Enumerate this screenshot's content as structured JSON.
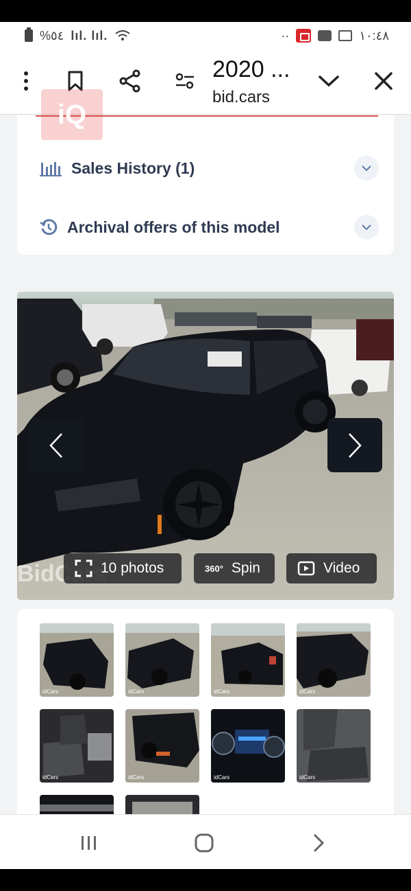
{
  "status_bar": {
    "battery_text": "%٥٤",
    "signal_text": "lıl. lıl.",
    "time": "١٠:٤٨",
    "dots": "··"
  },
  "toolbar": {
    "title": "2020 ...",
    "domain": "bid.cars"
  },
  "overlay_logo": "iQ",
  "sections": {
    "sales_history": "Sales History (1)",
    "archival_offers": "Archival offers of this model"
  },
  "gallery": {
    "photos_label": "10 photos",
    "spin_label": "Spin",
    "spin_badge": "360°",
    "video_label": "Video",
    "watermark": "BidCars"
  },
  "thumbnails": {
    "watermark": "idCars"
  },
  "colors": {
    "accent_red": "#d9534f",
    "heading": "#2f3b52",
    "nav_dark": "#141820"
  }
}
